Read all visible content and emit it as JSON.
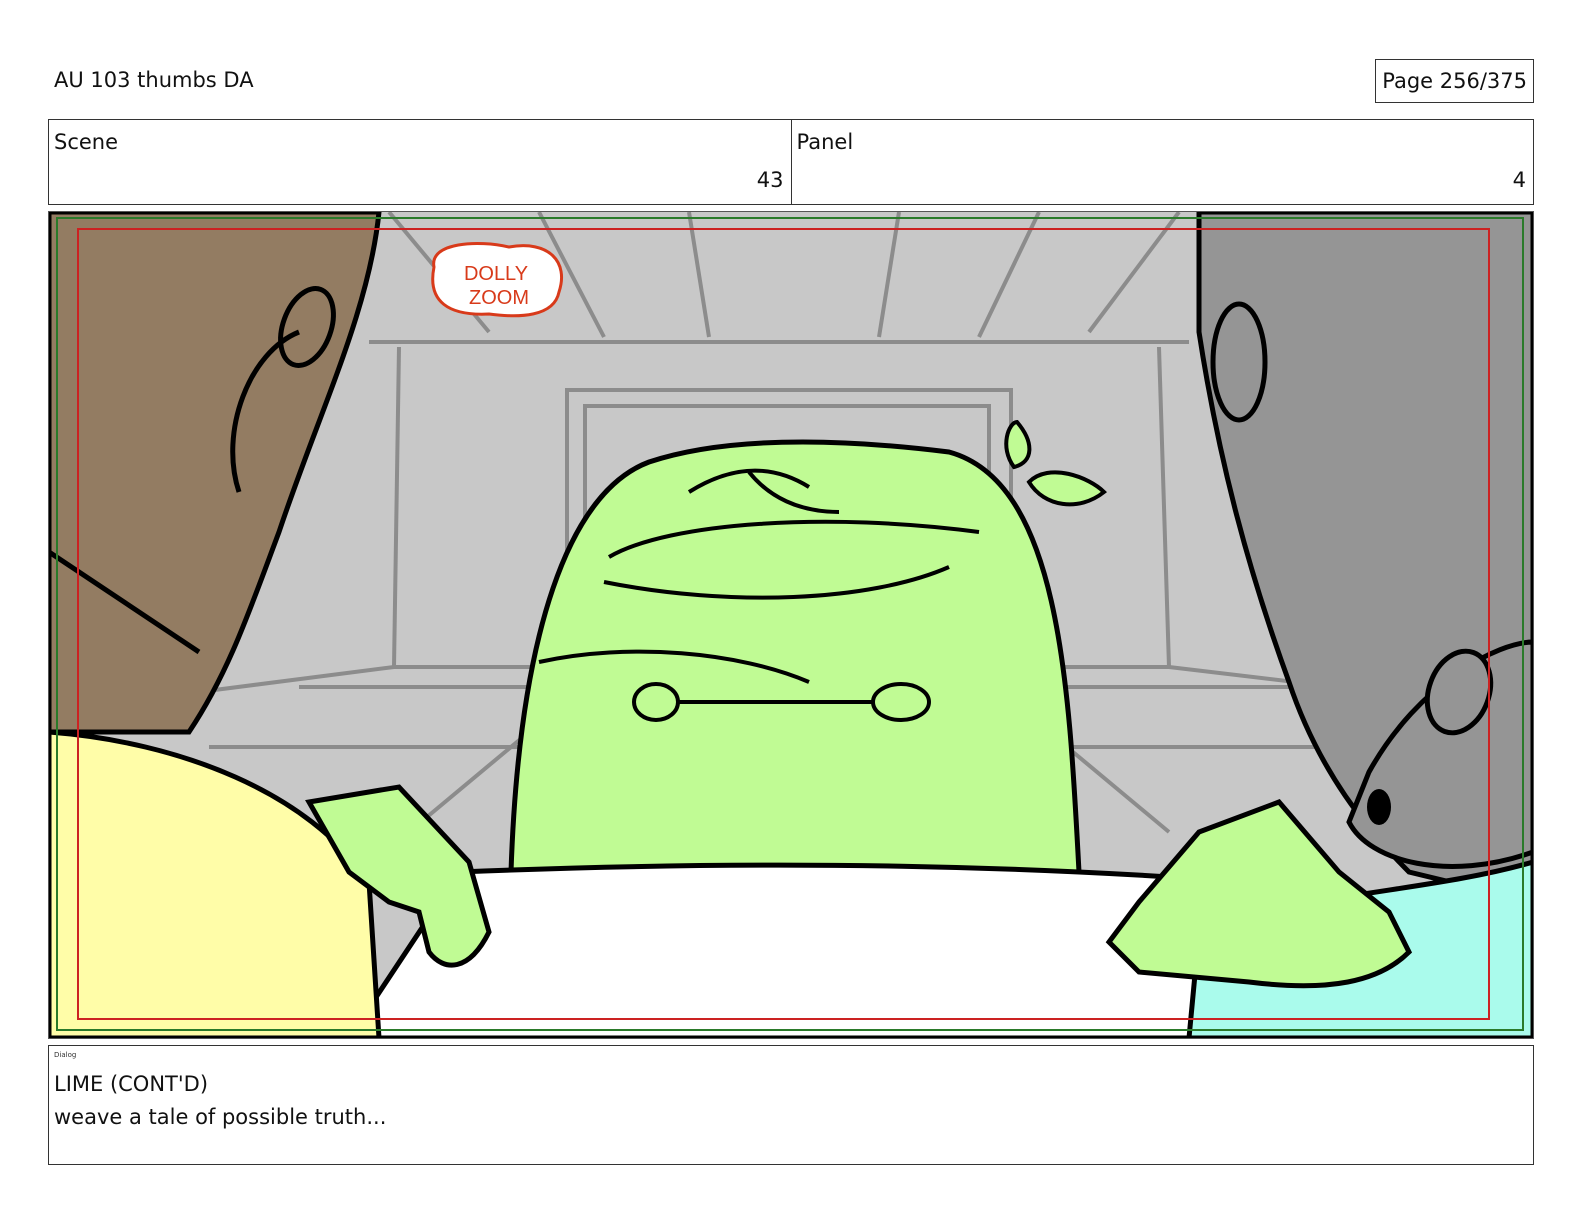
{
  "header": {
    "title": "AU 103 thumbs DA",
    "page_label": "Page 256/375"
  },
  "info": {
    "scene_label": "Scene",
    "scene_value": "43",
    "panel_label": "Panel",
    "panel_value": "4"
  },
  "panel": {
    "note_line1": "DOLLY",
    "note_line2": "ZOOM",
    "colors": {
      "wall": "#c8c8c8",
      "lime": "#c0fb94",
      "brown_character": "#937c62",
      "gray_character": "#959595",
      "yellow_shirt": "#fffda8",
      "cyan_shirt": "#aafbec",
      "safe_frame_green": "#2a7a2a",
      "safe_frame_red": "#cc2222",
      "note_red": "#d83a1a"
    }
  },
  "dialog": {
    "label": "Dialog",
    "character": "LIME (CONT'D)",
    "line": "weave a tale of possible truth..."
  }
}
